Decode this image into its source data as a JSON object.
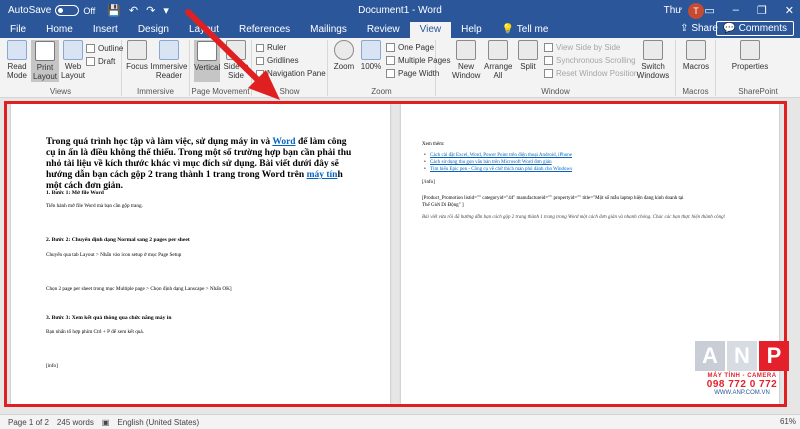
{
  "titlebar": {
    "autosave_label": "AutoSave",
    "autosave_state": "Off",
    "doc_title": "Document1 - Word",
    "user_name": "Thư",
    "avatar_initial": "T"
  },
  "tabs": [
    "File",
    "Home",
    "Insert",
    "Design",
    "Layout",
    "References",
    "Mailings",
    "Review",
    "View",
    "Help"
  ],
  "active_tab": "View",
  "tell_me": "Tell me",
  "share_label": "Share",
  "comments_label": "Comments",
  "ribbon": {
    "views": {
      "label": "Views",
      "read_mode": "Read Mode",
      "print_layout": "Print Layout",
      "web_layout": "Web Layout",
      "outline": "Outline",
      "draft": "Draft"
    },
    "immersive": {
      "label": "Immersive",
      "focus": "Focus",
      "immersive_reader": "Immersive Reader"
    },
    "page_movement": {
      "label": "Page Movement",
      "vertical": "Vertical",
      "side_to_side": "Side to Side"
    },
    "show": {
      "label": "Show",
      "ruler": "Ruler",
      "gridlines": "Gridlines",
      "navigation_pane": "Navigation Pane"
    },
    "zoom": {
      "label": "Zoom",
      "zoom": "Zoom",
      "hundred": "100%",
      "one_page": "One Page",
      "multiple_pages": "Multiple Pages",
      "page_width": "Page Width"
    },
    "window": {
      "label": "Window",
      "new_window": "New Window",
      "arrange_all": "Arrange All",
      "split": "Split",
      "view_side_by_side": "View Side by Side",
      "synchronous_scrolling": "Synchronous Scrolling",
      "reset_window_position": "Reset Window Position",
      "switch_windows": "Switch Windows"
    },
    "macros": {
      "label": "Macros",
      "macros": "Macros"
    },
    "sharepoint": {
      "label": "SharePoint",
      "properties": "Properties"
    }
  },
  "page1": {
    "intro_pre": "Trong quá trình học tập và làm việc, sử dụng máy in và ",
    "intro_link1": "Word",
    "intro_mid": " để làm công cụ in ấn là điều không thể thiếu. Trong một số trường hợp bạn cần phải thu nhỏ tài liệu về kích thước khác vì mục đích sử dụng. Bài viết dưới đây sẽ hướng dẫn bạn cách gộp 2 trang thành 1 trang trong Word trên ",
    "intro_link2": "máy tín",
    "intro_post": "h một cách đơn giản.",
    "step1_title": "1. Bước 1: Mở file Word",
    "step1_text": "Tiến hành mở file Word mà bạn cần gộp trang.",
    "step2_title": "2. Bước 2: Chuyển định dạng Normal sang 2 pages per sheet",
    "step2_text1": "Chuyển qua tab Layout > Nhấn vào icon setup ở mục Page Setup",
    "step2_text2": "Chọn 2 page per sheet trong mục Multiple page > Chọn định dạng Lanscape > Nhấn OK]",
    "step3_title": "3. Bước 3: Xem kết quả thông qua chức năng máy in",
    "step3_text": "Bạn nhấn tổ hợp phím Ctrl + P để xem kết quả.",
    "info": "[info]"
  },
  "page2": {
    "see_more": "Xem thêm:",
    "links": [
      "Cách cài đặt Excel, Word, Power Point trên điện thoại Android, iPhone",
      "Cách sử dụng thu gọn văn bản trên Microsoft Word đơn giản",
      "Tìm hiểu Epic pen - Công cụ vẽ chữ thích màn phủ dành cho Windows"
    ],
    "info_close": "[/info]",
    "product_line1": "[Product_Promotion listid=\"\" categoryid=\"44\" manufactureid=\"\" propertyid=\"\" title=\"Một số mẫu laptop hiện đang kinh doanh tại",
    "product_line2": "Thế Giới Di Động\" ]",
    "closing": "Bài viết vừa rồi đã hướng dẫn bạn cách gộp 2 trang thành 1 trang trong Word một cách đơn giản và nhanh chóng. Chúc các bạn thực hiện thành công!"
  },
  "watermark": {
    "letters": [
      "A",
      "N",
      "P"
    ],
    "tagline": "MÁY TÍNH - CAMERA",
    "phone": "098 772 0 772",
    "website": "WWW.ANP.COM.VN"
  },
  "statusbar": {
    "page": "Page 1 of 2",
    "words": "245 words",
    "language": "English (United States)",
    "zoom": "61%"
  },
  "colors": {
    "title_bar": "#2b579a",
    "highlight": "#e02020",
    "brand_red": "#e4202a"
  }
}
